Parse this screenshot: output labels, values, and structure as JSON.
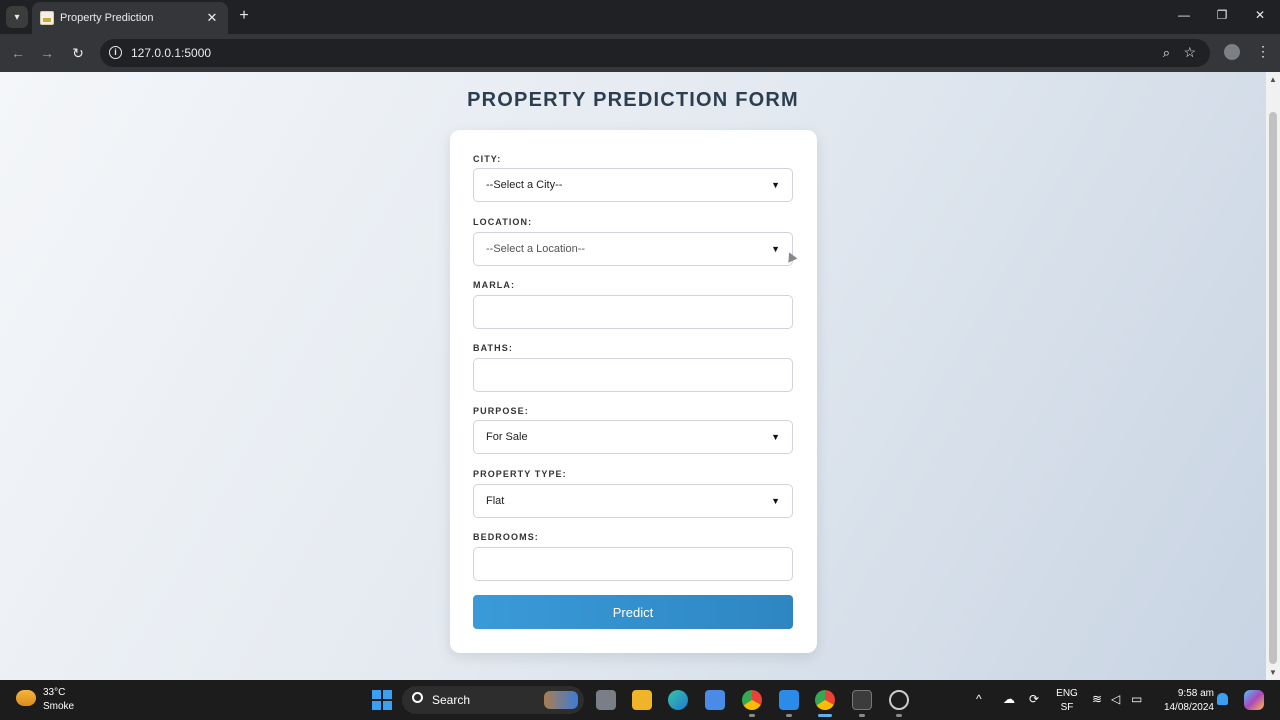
{
  "browser": {
    "tab_title": "Property Prediction",
    "url": "127.0.0.1:5000"
  },
  "page": {
    "title": "PROPERTY PREDICTION FORM"
  },
  "form": {
    "city": {
      "label": "CITY:",
      "selected": "--Select a City--"
    },
    "location": {
      "label": "LOCATION:",
      "selected": "--Select a Location--"
    },
    "marla": {
      "label": "MARLA:",
      "value": ""
    },
    "baths": {
      "label": "BATHS:",
      "value": ""
    },
    "purpose": {
      "label": "PURPOSE:",
      "selected": "For Sale"
    },
    "property_type": {
      "label": "PROPERTY TYPE:",
      "selected": "Flat"
    },
    "bedrooms": {
      "label": "BEDROOMS:",
      "value": ""
    },
    "submit_label": "Predict"
  },
  "taskbar": {
    "weather_temp": "33°C",
    "weather_desc": "Smoke",
    "search_label": "Search",
    "lang_top": "ENG",
    "lang_bottom": "SF",
    "time": "9:58 am",
    "date": "14/08/2024"
  },
  "colors": {
    "title": "#2c3e50",
    "button": "#3a9ad9",
    "page_bg_start": "#f4f6f9",
    "page_bg_end": "#c8d4e3"
  },
  "icons": [
    "tab-search-icon",
    "favicon-icon",
    "close-icon",
    "plus-icon",
    "back-icon",
    "forward-icon",
    "reload-icon",
    "info-icon",
    "zoom-icon",
    "star-icon",
    "profile-icon",
    "kebab-menu-icon",
    "chevron-down-icon",
    "windows-start-icon",
    "search-icon",
    "bell-icon",
    "copilot-icon"
  ]
}
